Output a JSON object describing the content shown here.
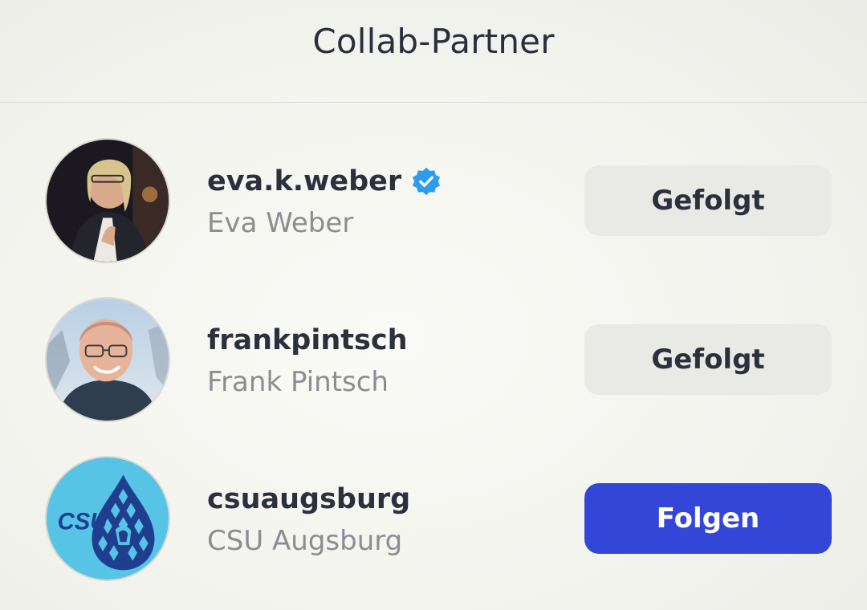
{
  "header": {
    "title": "Collab-Partner"
  },
  "colors": {
    "follow_button": "#3446d8",
    "followed_button": "#e9e9e5",
    "verified_badge": "#2c9bf0"
  },
  "partners": [
    {
      "username": "eva.k.weber",
      "full_name": "Eva Weber",
      "verified": true,
      "button_label": "Gefolgt",
      "avatar": "photo-woman-speaking"
    },
    {
      "username": "frankpintsch",
      "full_name": "Frank Pintsch",
      "verified": false,
      "button_label": "Gefolgt",
      "avatar": "photo-man-glasses"
    },
    {
      "username": "csuaugsburg",
      "full_name": "CSU Augsburg",
      "verified": false,
      "button_label": "Folgen",
      "avatar": "csu-logo"
    }
  ],
  "logo_text": "CSU"
}
